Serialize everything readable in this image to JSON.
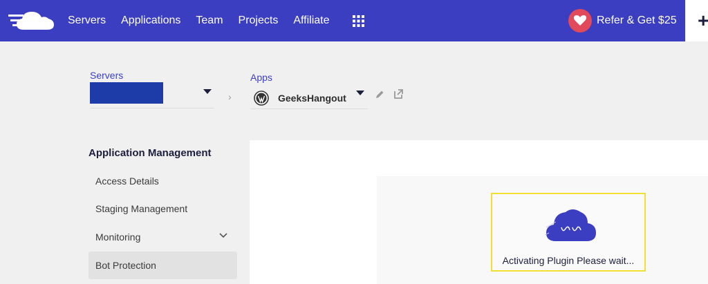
{
  "nav": {
    "items": [
      "Servers",
      "Applications",
      "Team",
      "Projects",
      "Affiliate"
    ],
    "refer_label": "Refer & Get $25",
    "plus_label": "+"
  },
  "breadcrumb": {
    "servers_label": "Servers",
    "apps_label": "Apps",
    "app_name": "GeeksHangout",
    "separator": "›"
  },
  "sidebar": {
    "title": "Application Management",
    "items": [
      "Access Details",
      "Staging Management",
      "Monitoring",
      "Bot Protection"
    ],
    "active_item": "Bot Protection"
  },
  "loading": {
    "message": "Activating Plugin Please wait..."
  },
  "colors": {
    "brand": "#3b3ec1",
    "heart": "#e04a5a",
    "highlight_border": "#f2e030",
    "redaction": "#1e3ca7"
  },
  "icons": {
    "logo": "cloudways-logo",
    "apps_grid": "grid-icon",
    "heart": "heart-icon",
    "wordpress": "wordpress-icon",
    "edit": "pencil-icon",
    "open": "external-link-icon",
    "loader": "cloud-icon"
  }
}
